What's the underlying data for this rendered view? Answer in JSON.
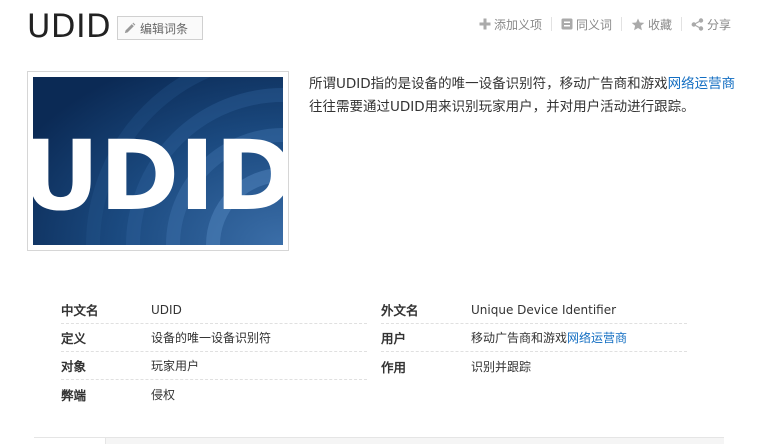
{
  "header": {
    "title": "UDID",
    "edit_label": "编辑词条",
    "actions": [
      {
        "label": "添加义项",
        "icon": "plus-icon"
      },
      {
        "label": "同义词",
        "icon": "synonym-icon"
      },
      {
        "label": "收藏",
        "icon": "star-icon"
      },
      {
        "label": "分享",
        "icon": "share-icon"
      }
    ]
  },
  "image": {
    "text": "UDID",
    "colors": {
      "bg_dark": "#0d2f5e",
      "bg_light": "#2a5d97",
      "text": "#ffffff"
    }
  },
  "summary": {
    "part1": "所谓UDID指的是设备的唯一设备识别符，移动广告商和游戏",
    "link": "网络运营商",
    "part2": "往往需要通过UDID用来识别玩家用户，并对用户活动进行跟踪。"
  },
  "info": {
    "left": [
      {
        "key": "中文名",
        "value": "UDID"
      },
      {
        "key": "定义",
        "value": "设备的唯一设备识别符"
      },
      {
        "key": "对象",
        "value": "玩家用户"
      },
      {
        "key": "弊端",
        "value": "侵权"
      }
    ],
    "right": [
      {
        "key": "外文名",
        "value": "Unique Device Identifier"
      },
      {
        "key": "用户",
        "value": "移动广告商和游戏",
        "link": "网络运营商"
      },
      {
        "key": "作用",
        "value": "识别并跟踪"
      }
    ]
  },
  "colors": {
    "link": "#136ec2",
    "muted": "#888888"
  }
}
